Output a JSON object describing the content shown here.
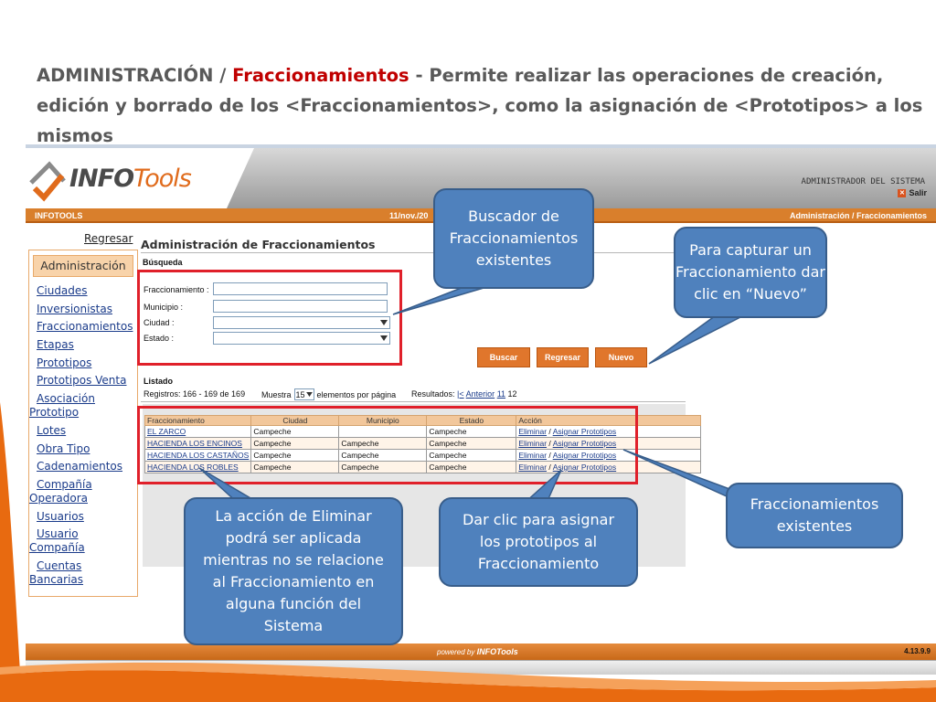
{
  "slide": {
    "title_part1": "ADMINISTRACIÓN / ",
    "title_accent": "Fraccionamientos",
    "title_part2": " - Permite realizar las operaciones de creación, edición y borrado de los <Fraccionamientos>, como la asignación de <Prototipos> a los mismos"
  },
  "app": {
    "logo_brand": "INFO",
    "logo_brand2": "Tools",
    "user_role": "ADMINISTRADOR DEL SISTEMA",
    "logout_label": "Salir",
    "navbar": {
      "left": "INFOTOOLS",
      "date": "11/nov./20",
      "breadcrumb": "Administración / Fraccionamientos"
    },
    "back_link": "Regresar",
    "sidebar": {
      "header": "Administración",
      "items": [
        "Ciudades",
        "Inversionistas",
        "Fraccionamientos",
        "Etapas",
        "Prototipos",
        "Prototipos Venta"
      ],
      "items2": [
        {
          "l1": "Asociación",
          "l2": "Prototipo"
        }
      ],
      "items3": [
        "Lotes",
        "Obra Tipo",
        "Cadenamientos"
      ],
      "items4": [
        {
          "l1": "Compañía",
          "l2": "Operadora"
        }
      ],
      "items5": [
        "Usuarios"
      ],
      "items6": [
        {
          "l1": "Usuario",
          "l2": "Compañía"
        },
        {
          "l1": "Cuentas",
          "l2": "Bancarias"
        }
      ]
    },
    "page_title": "Administración de Fraccionamientos",
    "search": {
      "section_label": "Búsqueda",
      "fraccionamiento_label": "Fraccionamiento :",
      "municipio_label": "Municipio :",
      "ciudad_label": "Ciudad :",
      "estado_label": "Estado :",
      "fraccionamiento_value": "",
      "municipio_value": ""
    },
    "buttons": {
      "buscar": "Buscar",
      "regresar": "Regresar",
      "nuevo": "Nuevo"
    },
    "listing": {
      "section_label": "Listado",
      "registros": "Registros: 166 - 169 de 169",
      "muestra_label": "Muestra",
      "page_size": "15",
      "per_page_label": "elementos por página",
      "resultados_label": "Resultados:",
      "first_link": "|<",
      "prev_link": "Anterior",
      "page_link": "11",
      "current_page": "12"
    },
    "table": {
      "headers": [
        "Fraccionamiento",
        "Ciudad",
        "Municipio",
        "Estado",
        "Acción"
      ],
      "rows": [
        {
          "fracc": "EL ZARCO",
          "ciudad": "Campeche",
          "municipio": "",
          "estado": "Campeche"
        },
        {
          "fracc": "HACIENDA LOS ENCINOS",
          "ciudad": "Campeche",
          "municipio": "Campeche",
          "estado": "Campeche"
        },
        {
          "fracc": "HACIENDA LOS CASTAÑOS",
          "ciudad": "Campeche",
          "municipio": "Campeche",
          "estado": "Campeche"
        },
        {
          "fracc": "HACIENDA LOS ROBLES",
          "ciudad": "Campeche",
          "municipio": "Campeche",
          "estado": "Campeche"
        }
      ],
      "action_delete": "Eliminar",
      "action_sep": "/",
      "action_assign": "Asignar Prototipos"
    },
    "footer": {
      "powered_by": "powered by",
      "powered_brand": "INFOTools",
      "version": "4.13.9.9"
    }
  },
  "callouts": {
    "buscador": "Buscador de Fraccionamientos existentes",
    "nuevo": "Para capturar un Fraccionamiento dar clic en “Nuevo”",
    "existentes": "Fraccionamientos existentes",
    "eliminar": "La acción de Eliminar podrá ser aplicada mientras no se relacione al Fraccionamiento en alguna función del Sistema",
    "asignar": "Dar clic para asignar los prototipos al Fraccionamiento"
  },
  "colors": {
    "accent_orange": "#e0762c",
    "callout_blue": "#4f81bd",
    "highlight_red": "#e0202a",
    "title_red": "#c00000"
  }
}
